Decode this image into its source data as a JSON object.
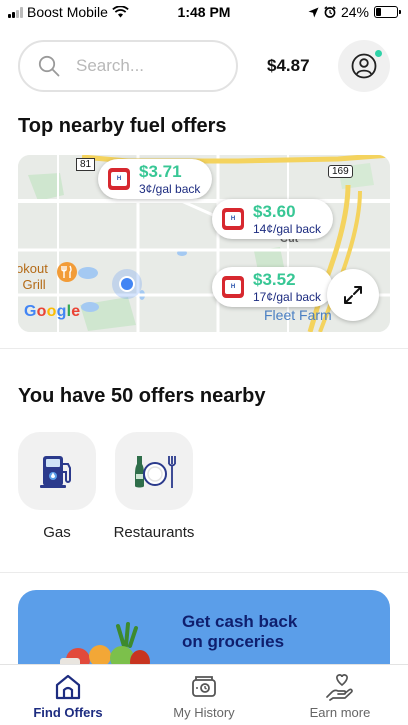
{
  "status_bar": {
    "carrier": "Boost Mobile",
    "time": "1:48 PM",
    "battery": "24%",
    "battery_level": 0.24
  },
  "header": {
    "search_placeholder": "Search...",
    "balance": "$4.87"
  },
  "fuel_section": {
    "title": "Top nearby fuel offers",
    "offers": [
      {
        "brand": "Holiday",
        "price": "$3.71",
        "cashback": "3¢/gal back"
      },
      {
        "brand": "Holiday",
        "price": "$3.60",
        "cashback": "14¢/gal back"
      },
      {
        "brand": "Holiday",
        "price": "$3.52",
        "cashback": "17¢/gal back"
      }
    ],
    "map": {
      "attribution": "Google",
      "highway_labels": [
        "81",
        "169"
      ],
      "place_labels": [
        "okout",
        "l Grill",
        "Fleet Farm",
        "Cut"
      ]
    }
  },
  "offers_section": {
    "title": "You have 50 offers nearby",
    "categories": [
      {
        "label": "Gas",
        "icon": "gas-pump-icon"
      },
      {
        "label": "Restaurants",
        "icon": "dining-plate-icon"
      }
    ]
  },
  "promo": {
    "line1": "Get cash back",
    "line2": "on groceries"
  },
  "tabbar": {
    "tabs": [
      {
        "label": "Find Offers",
        "icon": "home-icon",
        "active": true
      },
      {
        "label": "My History",
        "icon": "wallet-history-icon",
        "active": false
      },
      {
        "label": "Earn more",
        "icon": "heart-hand-icon",
        "active": false
      }
    ]
  },
  "colors": {
    "accent_navy": "#1d2c80",
    "price_green": "#38c795",
    "promo_blue": "#5b9ee9",
    "holiday_red": "#d7282f"
  }
}
